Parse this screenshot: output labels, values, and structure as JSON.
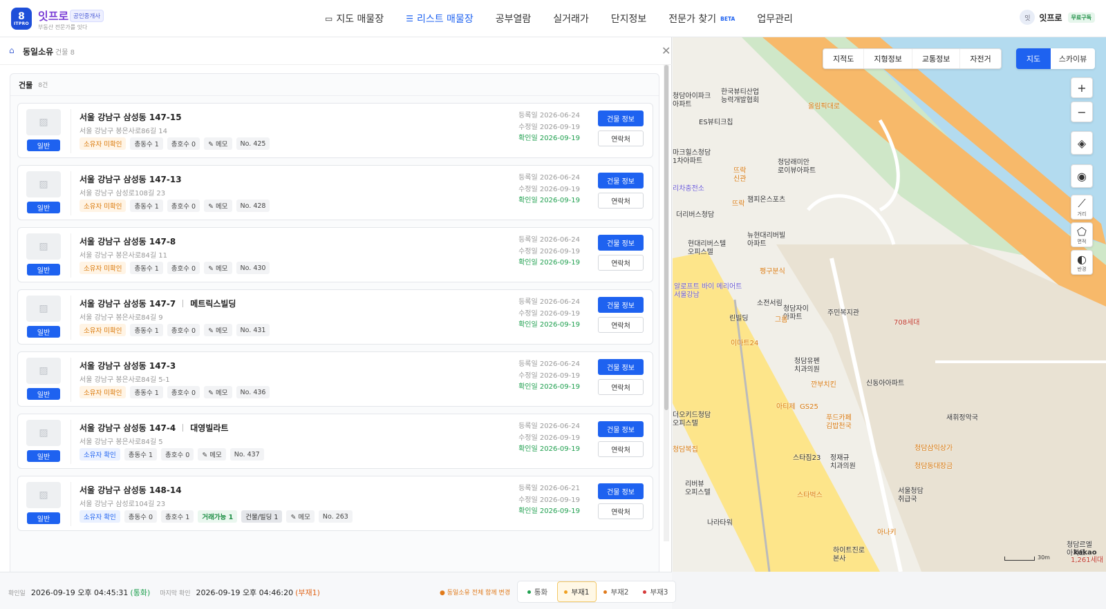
{
  "brand": {
    "logo_glyph": "8",
    "logo_text": "ITPRO",
    "name": "잇프로",
    "badge": "공인중개사",
    "sub": "부동산 전문가를 잇다"
  },
  "nav": [
    {
      "label": "지도 매물장",
      "icon": "map-icon",
      "active": false
    },
    {
      "label": "리스트 매물장",
      "icon": "list-icon",
      "active": true
    },
    {
      "label": "공부열람",
      "active": false
    },
    {
      "label": "실거래가",
      "active": false
    },
    {
      "label": "단지정보",
      "active": false
    },
    {
      "label": "전문가 찾기",
      "badge": "BETA",
      "active": false
    },
    {
      "label": "업무관리",
      "active": false
    }
  ],
  "user": {
    "avatar": "잇",
    "name": "잇프로",
    "plan": "무료구독"
  },
  "panel": {
    "title": "동일소유",
    "count": "건물 8",
    "list_title": "건물",
    "list_count": "8건"
  },
  "cards": [
    {
      "kind": "일반",
      "address": "서울 강남구 삼성동 147-15",
      "building": "",
      "road": "서울 강남구 봉은사로86길 14",
      "tags": [
        {
          "t": "소유자 미확인",
          "c": "warn"
        },
        {
          "t": "총동수 1"
        },
        {
          "t": "총호수 0"
        },
        {
          "t": "✎ 메모"
        },
        {
          "t": "No. 425"
        }
      ],
      "registered": "등록일 2026-06-24",
      "modified": "수정일 2026-09-19",
      "confirmed": "확인일 2026-09-19",
      "btn_info": "건물 정보",
      "btn_contact": "연락처"
    },
    {
      "kind": "일반",
      "address": "서울 강남구 삼성동 147-13",
      "building": "",
      "road": "서울 강남구 삼성로108길 23",
      "tags": [
        {
          "t": "소유자 미확인",
          "c": "warn"
        },
        {
          "t": "총동수 1"
        },
        {
          "t": "총호수 0"
        },
        {
          "t": "✎ 메모"
        },
        {
          "t": "No. 428"
        }
      ],
      "registered": "등록일 2026-06-24",
      "modified": "수정일 2026-09-19",
      "confirmed": "확인일 2026-09-19",
      "btn_info": "건물 정보",
      "btn_contact": "연락처"
    },
    {
      "kind": "일반",
      "address": "서울 강남구 삼성동 147-8",
      "building": "",
      "road": "서울 강남구 봉은사로84길 11",
      "tags": [
        {
          "t": "소유자 미확인",
          "c": "warn"
        },
        {
          "t": "총동수 1"
        },
        {
          "t": "총호수 0"
        },
        {
          "t": "✎ 메모"
        },
        {
          "t": "No. 430"
        }
      ],
      "registered": "등록일 2026-06-24",
      "modified": "수정일 2026-09-19",
      "confirmed": "확인일 2026-09-19",
      "btn_info": "건물 정보",
      "btn_contact": "연락처"
    },
    {
      "kind": "일반",
      "address": "서울 강남구 삼성동 147-7",
      "building": "메트릭스빌딩",
      "road": "서울 강남구 봉은사로84길 9",
      "tags": [
        {
          "t": "소유자 미확인",
          "c": "warn"
        },
        {
          "t": "총동수 1"
        },
        {
          "t": "총호수 0"
        },
        {
          "t": "✎ 메모"
        },
        {
          "t": "No. 431"
        }
      ],
      "registered": "등록일 2026-06-24",
      "modified": "수정일 2026-09-19",
      "confirmed": "확인일 2026-09-19",
      "btn_info": "건물 정보",
      "btn_contact": "연락처"
    },
    {
      "kind": "일반",
      "address": "서울 강남구 삼성동 147-3",
      "building": "",
      "road": "서울 강남구 봉은사로84길 5-1",
      "tags": [
        {
          "t": "소유자 미확인",
          "c": "warn"
        },
        {
          "t": "총동수 1"
        },
        {
          "t": "총호수 0"
        },
        {
          "t": "✎ 메모"
        },
        {
          "t": "No. 436"
        }
      ],
      "registered": "등록일 2026-06-24",
      "modified": "수정일 2026-09-19",
      "confirmed": "확인일 2026-09-19",
      "btn_info": "건물 정보",
      "btn_contact": "연락처"
    },
    {
      "kind": "일반",
      "address": "서울 강남구 삼성동 147-4",
      "building": "대영빌라트",
      "road": "서울 강남구 봉은사로84길 5",
      "tags": [
        {
          "t": "소유자 확인",
          "c": "ok"
        },
        {
          "t": "총동수 1"
        },
        {
          "t": "총호수 0"
        },
        {
          "t": "✎ 메모"
        },
        {
          "t": "No. 437"
        }
      ],
      "registered": "등록일 2026-06-24",
      "modified": "수정일 2026-09-19",
      "confirmed": "확인일 2026-09-19",
      "btn_info": "건물 정보",
      "btn_contact": "연락처"
    },
    {
      "kind": "일반",
      "address": "서울 강남구 삼성동 148-14",
      "building": "",
      "road": "서울 강남구 삼성로104길 23",
      "tags": [
        {
          "t": "소유자 확인",
          "c": "ok"
        },
        {
          "t": "총동수 0"
        },
        {
          "t": "총호수 1"
        },
        {
          "t": "거래가능 1",
          "c": "green"
        },
        {
          "t": "건물/빌딩 1",
          "c": "gray"
        },
        {
          "t": "✎ 메모"
        },
        {
          "t": "No. 263"
        }
      ],
      "registered": "등록일 2026-06-21",
      "modified": "수정일 2026-09-19",
      "confirmed": "확인일 2026-09-19",
      "btn_info": "건물 정보",
      "btn_contact": "연락처"
    }
  ],
  "footer": {
    "confirm_label": "확인일",
    "confirm_time": "2026-09-19 오후 04:45:31",
    "confirm_status": "(통화)",
    "last_label": "마지막 확인",
    "last_time": "2026-09-19 오후 04:46:20",
    "last_status": "(부재1)",
    "change_all": "● 동일소유 전체 함께 변경",
    "segments": [
      {
        "label": "통화",
        "color": "#1e9f4e",
        "selected": false
      },
      {
        "label": "부재1",
        "color": "#f0a020",
        "selected": true
      },
      {
        "label": "부재2",
        "color": "#e07a1b",
        "selected": false
      },
      {
        "label": "부재3",
        "color": "#d63a3a",
        "selected": false
      }
    ]
  },
  "map": {
    "tabs": [
      "지적도",
      "지형정보",
      "교통정보",
      "자전거"
    ],
    "view_tabs": [
      "지도",
      "스카이뷰"
    ],
    "controls": [
      {
        "icon": "zoom-in-icon",
        "glyph": "+"
      },
      {
        "icon": "zoom-out-icon",
        "glyph": "−"
      },
      {
        "icon": "locate-icon",
        "glyph": "◈"
      },
      {
        "icon": "pin-icon",
        "glyph": "◉"
      },
      {
        "icon": "distance-icon",
        "glyph": "⟋",
        "label": "거리"
      },
      {
        "icon": "area-icon",
        "glyph": "⬠",
        "label": "면적"
      },
      {
        "icon": "radius-icon",
        "glyph": "◐",
        "label": "반경"
      }
    ],
    "scale": "30m",
    "provider": "kakao",
    "labels": [
      {
        "t": "한국뷰티산업\n능력개발협회",
        "c": ""
      },
      {
        "t": "청담아이파크\n아파트",
        "c": ""
      },
      {
        "t": "ES뷰티크칩",
        "c": ""
      },
      {
        "t": "올림픽대로",
        "c": "o"
      },
      {
        "t": "마크힐스청담\n1차아파트",
        "c": ""
      },
      {
        "t": "청담래미안\n로이뷰아파트",
        "c": ""
      },
      {
        "t": "뜨락\n신관",
        "c": "o"
      },
      {
        "t": "리차충전소",
        "c": "p"
      },
      {
        "t": "챔피온스포츠",
        "c": ""
      },
      {
        "t": "뜨락",
        "c": "o"
      },
      {
        "t": "더리버스청담",
        "c": ""
      },
      {
        "t": "뉴현대리버빌\n아파트",
        "c": ""
      },
      {
        "t": "현대리버스텔\n오피스텔",
        "c": ""
      },
      {
        "t": "쩡구분식",
        "c": "o"
      },
      {
        "t": "알로프트 바이 메리어트\n서울강남",
        "c": "p"
      },
      {
        "t": "소전서림",
        "c": ""
      },
      {
        "t": "청담자이\n아파트",
        "c": ""
      },
      {
        "t": "주민복지관",
        "c": ""
      },
      {
        "t": "린빌딩",
        "c": ""
      },
      {
        "t": "그롬",
        "c": "o"
      },
      {
        "t": "이마트24",
        "c": "o"
      },
      {
        "t": "청담유펜\n치과의원",
        "c": ""
      },
      {
        "t": "깐부치킨",
        "c": "o"
      },
      {
        "t": "신동아아파트",
        "c": ""
      },
      {
        "t": "더오키드청담\n오피스텔",
        "c": ""
      },
      {
        "t": "아티제",
        "c": "o"
      },
      {
        "t": "GS25",
        "c": "o"
      },
      {
        "t": "푸드카페\n김밥천국",
        "c": "o"
      },
      {
        "t": "새휘정악국",
        "c": ""
      },
      {
        "t": "청담복집",
        "c": "o"
      },
      {
        "t": "청담삼익상가",
        "c": "o"
      },
      {
        "t": "스타짐23",
        "c": ""
      },
      {
        "t": "정재규\n치과의원",
        "c": ""
      },
      {
        "t": "청담동대장금",
        "c": "o"
      },
      {
        "t": "리버뷰\n오피스텔",
        "c": ""
      },
      {
        "t": "스타벅스",
        "c": "o"
      },
      {
        "t": "서울청담\n취급국",
        "c": ""
      },
      {
        "t": "나라타워",
        "c": ""
      },
      {
        "t": "아나키",
        "c": "o"
      },
      {
        "t": "하이트진로\n본사",
        "c": ""
      },
      {
        "t": "청담르엘\n아파트",
        "c": ""
      },
      {
        "t": "1,261세대",
        "c": "r"
      },
      {
        "t": "708세대",
        "c": "r"
      }
    ]
  }
}
